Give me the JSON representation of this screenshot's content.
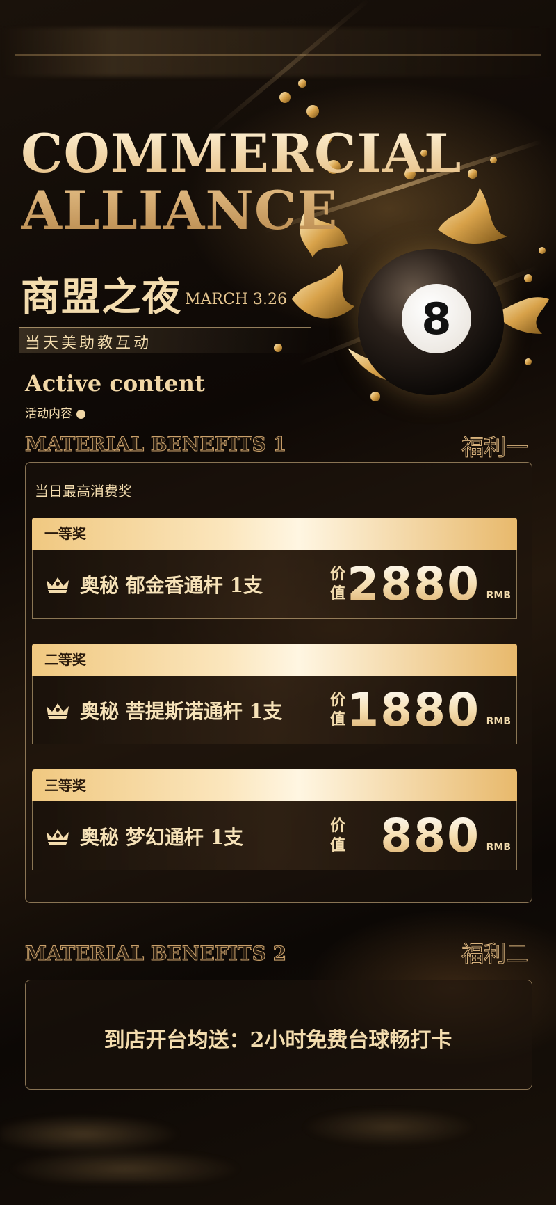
{
  "hero": {
    "title_en": "COMMERCIAL\nALLIANCE",
    "title_cn": "商盟之夜",
    "date": "MARCH 3.26",
    "subtitle": "当天美助教互动",
    "ball_number": "8"
  },
  "activity": {
    "heading_en": "Active content",
    "heading_cn": "活动内容"
  },
  "benefits1": {
    "section_en": "MATERIAL BENEFITS 1",
    "section_cn": "福利一",
    "panel_title": "当日最高消费奖",
    "tiers": [
      {
        "rank": "一等奖",
        "prize": "奥秘 郁金香通杆 1支",
        "value_label": "价值",
        "amount": "2880",
        "unit": "RMB"
      },
      {
        "rank": "二等奖",
        "prize": "奥秘 菩提斯诺通杆 1支",
        "value_label": "价值",
        "amount": "1880",
        "unit": "RMB"
      },
      {
        "rank": "三等奖",
        "prize": "奥秘 梦幻通杆 1支",
        "value_label": "价值",
        "amount": "880",
        "unit": "RMB"
      }
    ]
  },
  "benefits2": {
    "section_en": "MATERIAL BENEFITS 2",
    "section_cn": "福利二",
    "text": "到店开台均送：2小时免费台球畅打卡"
  },
  "colors": {
    "gold": "#e8c891",
    "gold_light": "#f6e2b8",
    "background": "#0f0a06"
  },
  "icons": [
    "crown-icon"
  ]
}
